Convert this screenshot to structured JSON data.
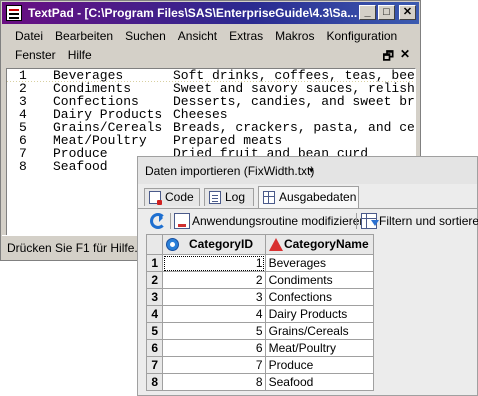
{
  "textpad": {
    "title": "TextPad - [C:\\Program Files\\SAS\\EnterpriseGuide\\4.3\\Sa...",
    "window_buttons": {
      "minimize": "_",
      "maximize": "□",
      "close": "✕"
    },
    "menu_row1": [
      "Datei",
      "Bearbeiten",
      "Suchen",
      "Ansicht",
      "Extras",
      "Makros",
      "Konfiguration"
    ],
    "menu_row2": [
      "Fenster",
      "Hilfe"
    ],
    "mdi_buttons": {
      "restore": "🗗",
      "close": "✕"
    },
    "lines": [
      {
        "num": "1",
        "name": "Beverages",
        "desc": "Soft drinks, coffees, teas, bee"
      },
      {
        "num": "2",
        "name": "Condiments",
        "desc": "Sweet and savory sauces, relish"
      },
      {
        "num": "3",
        "name": "Confections",
        "desc": "Desserts, candies, and sweet br"
      },
      {
        "num": "4",
        "name": "Dairy Products",
        "desc": "Cheeses"
      },
      {
        "num": "5",
        "name": "Grains/Cereals",
        "desc": "Breads, crackers, pasta, and ce"
      },
      {
        "num": "6",
        "name": "Meat/Poultry",
        "desc": "Prepared meats"
      },
      {
        "num": "7",
        "name": "Produce",
        "desc": "Dried fruit and bean curd"
      },
      {
        "num": "8",
        "name": "Seafood",
        "desc": ""
      }
    ],
    "status": "Drücken Sie F1 für Hilfe."
  },
  "sas": {
    "header_title": "Daten importieren (FixWidth.txt)",
    "header_arrow": "▾",
    "tabs": [
      {
        "label": "Code",
        "icon": "code-icon"
      },
      {
        "label": "Log",
        "icon": "log-icon"
      },
      {
        "label": "Ausgabedaten",
        "icon": "table-icon"
      }
    ],
    "toolbar": {
      "modify_label": "Anwendungsroutine modifizieren",
      "filter_label": "Filtern und sortieren"
    },
    "columns": {
      "id": "CategoryID",
      "name": "CategoryName"
    },
    "rows": [
      {
        "rn": "1",
        "id": "1",
        "name": "Beverages"
      },
      {
        "rn": "2",
        "id": "2",
        "name": "Condiments"
      },
      {
        "rn": "3",
        "id": "3",
        "name": "Confections"
      },
      {
        "rn": "4",
        "id": "4",
        "name": "Dairy Products"
      },
      {
        "rn": "5",
        "id": "5",
        "name": "Grains/Cereals"
      },
      {
        "rn": "6",
        "id": "6",
        "name": "Meat/Poultry"
      },
      {
        "rn": "7",
        "id": "7",
        "name": "Produce"
      },
      {
        "rn": "8",
        "id": "8",
        "name": "Seafood"
      }
    ]
  }
}
